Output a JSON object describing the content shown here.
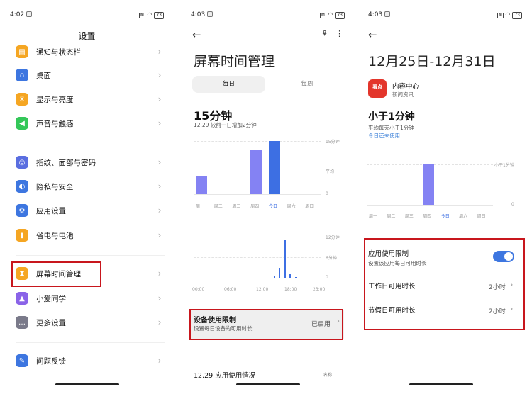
{
  "panel1": {
    "status": {
      "time": "4:02",
      "battery": "73"
    },
    "title": "设置",
    "items": [
      {
        "label": "通知与状态栏",
        "icon": "notification-icon",
        "color": "#f5a623"
      },
      {
        "label": "桌面",
        "icon": "home-icon",
        "color": "#3d76e0"
      },
      {
        "label": "显示与亮度",
        "icon": "sun-icon",
        "color": "#f5a623"
      },
      {
        "label": "声音与触感",
        "icon": "speaker-icon",
        "color": "#34c759"
      },
      {
        "label": "指纹、面部与密码",
        "icon": "fingerprint-icon",
        "color": "#5a6ee0"
      },
      {
        "label": "隐私与安全",
        "icon": "privacy-icon",
        "color": "#3d76e0"
      },
      {
        "label": "应用设置",
        "icon": "app-settings-icon",
        "color": "#3d76e0"
      },
      {
        "label": "省电与电池",
        "icon": "battery-icon",
        "color": "#f5a623"
      },
      {
        "label": "屏幕时间管理",
        "icon": "hourglass-icon",
        "color": "#f5a623"
      },
      {
        "label": "小爱同学",
        "icon": "xiaoai-icon",
        "color": "#8a63e8"
      },
      {
        "label": "更多设置",
        "icon": "more-icon",
        "color": "#7a7a8a"
      },
      {
        "label": "问题反馈",
        "icon": "feedback-icon",
        "color": "#3d76e0"
      }
    ]
  },
  "panel2": {
    "status": {
      "time": "4:03",
      "battery": "73"
    },
    "title": "屏幕时间管理",
    "tabs": {
      "daily": "每日",
      "weekly": "每周"
    },
    "total": "15分钟",
    "compare": "12.29 较前一日增加2分钟",
    "chart_data": [
      {
        "type": "bar",
        "categories": [
          "周一",
          "周二",
          "周三",
          "周四",
          "今日",
          "周六",
          "周日"
        ],
        "values": [
          5,
          0,
          0,
          12.5,
          15,
          0,
          0
        ],
        "y_labels": [
          "15分钟",
          "平均",
          "0"
        ],
        "highlight": "今日"
      },
      {
        "type": "bar",
        "x_labels": [
          "00:00",
          "06:00",
          "12:00",
          "18:00",
          "23:00"
        ],
        "y_labels": [
          "12分钟",
          "6分钟",
          "0"
        ],
        "values": [
          0,
          0,
          0,
          0,
          0,
          0,
          0,
          0,
          0,
          0,
          0,
          0,
          0,
          0,
          0,
          0.5,
          3,
          11,
          1,
          0.2,
          0,
          0,
          0,
          0,
          0
        ]
      }
    ],
    "device_limit": {
      "title": "设备使用限制",
      "desc": "设置每日设备的可用时长",
      "status": "已启用"
    },
    "usage_header": {
      "title": "12.29 应用使用情况",
      "sort": "名称"
    }
  },
  "panel3": {
    "status": {
      "time": "4:03",
      "battery": "73"
    },
    "date_range": "12月25日-12月31日",
    "app": {
      "name": "内容中心",
      "category": "新闻资讯",
      "logo_text": "看点"
    },
    "usage": "小于1分钟",
    "avg": "平均每天小于1分钟",
    "today": "今日还未使用",
    "chart_data": {
      "type": "bar",
      "categories": [
        "周一",
        "周二",
        "周三",
        "周四",
        "今日",
        "周六",
        "周日"
      ],
      "values": [
        0,
        0,
        0,
        1,
        0,
        0,
        0
      ],
      "y_labels": [
        "小于1分钟",
        "0"
      ],
      "highlight": "今日"
    },
    "limit": {
      "title": "应用使用限制",
      "desc": "设置该应用每日可用时长",
      "enabled": true
    },
    "workday": {
      "label": "工作日可用时长",
      "value": "2小时"
    },
    "holiday": {
      "label": "节假日可用时长",
      "value": "2小时"
    }
  }
}
